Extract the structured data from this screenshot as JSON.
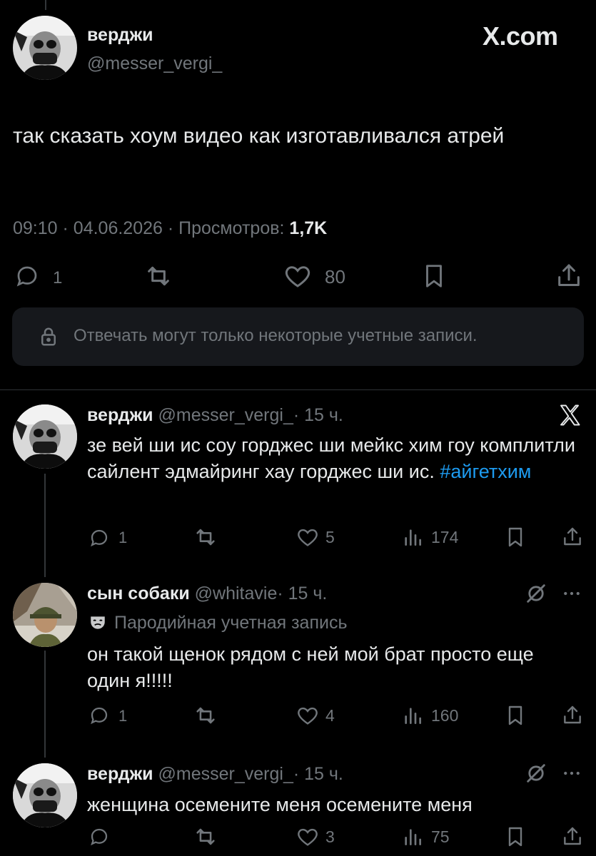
{
  "main_post": {
    "author_name": "верджи",
    "author_handle": "@messer_vergi_",
    "site_label": "X.com",
    "text": "так сказать хоум видео как изготавливался атрей",
    "meta": {
      "time": "09:10",
      "sep1": "·",
      "date": "04.06.2026",
      "sep2": "·",
      "views_label": "Просмотров:",
      "views_value": "1,7K"
    },
    "actions": {
      "replies": "1",
      "likes": "80"
    },
    "reply_restriction": "Отвечать могут только некоторые учетные записи."
  },
  "replies": [
    {
      "author_name": "верджи",
      "author_handle": "@messer_vergi_",
      "time_sep": "·",
      "time": "15 ч.",
      "text": "зе вей ши ис соу горджес ши мейкс хим гоу комплитли сайлент эдмайринг хау горджес ши ис.",
      "hashtag": "#айгетхим",
      "replies": "1",
      "likes": "5",
      "views": "174"
    },
    {
      "author_name": "сын собаки",
      "author_handle": "@whitavie",
      "time_sep": "·",
      "time": "15 ч.",
      "badge": "Пародийная учетная запись",
      "text": "он такой щенок рядом с ней мой брат просто еще один я!!!!!",
      "replies": "1",
      "likes": "4",
      "views": "160"
    },
    {
      "author_name": "верджи",
      "author_handle": "@messer_vergi_",
      "time_sep": "·",
      "time": "15 ч.",
      "text": "женщина осемените меня осемените меня",
      "likes": "3",
      "views": "75"
    }
  ],
  "icons": {
    "reply": "reply-icon",
    "repost": "repost-icon",
    "like": "heart-icon",
    "bookmark": "bookmark-icon",
    "share": "share-icon",
    "views": "views-icon",
    "lock": "lock-icon",
    "x_logo": "x-logo-icon",
    "grok": "grok-icon",
    "more": "more-icon",
    "parody": "parody-mask-icon"
  },
  "colors": {
    "background": "#000000",
    "text": "#e7e9ea",
    "muted": "#71767b",
    "link": "#1d9bf0",
    "panel": "#16181c",
    "divider": "#2f3336"
  }
}
